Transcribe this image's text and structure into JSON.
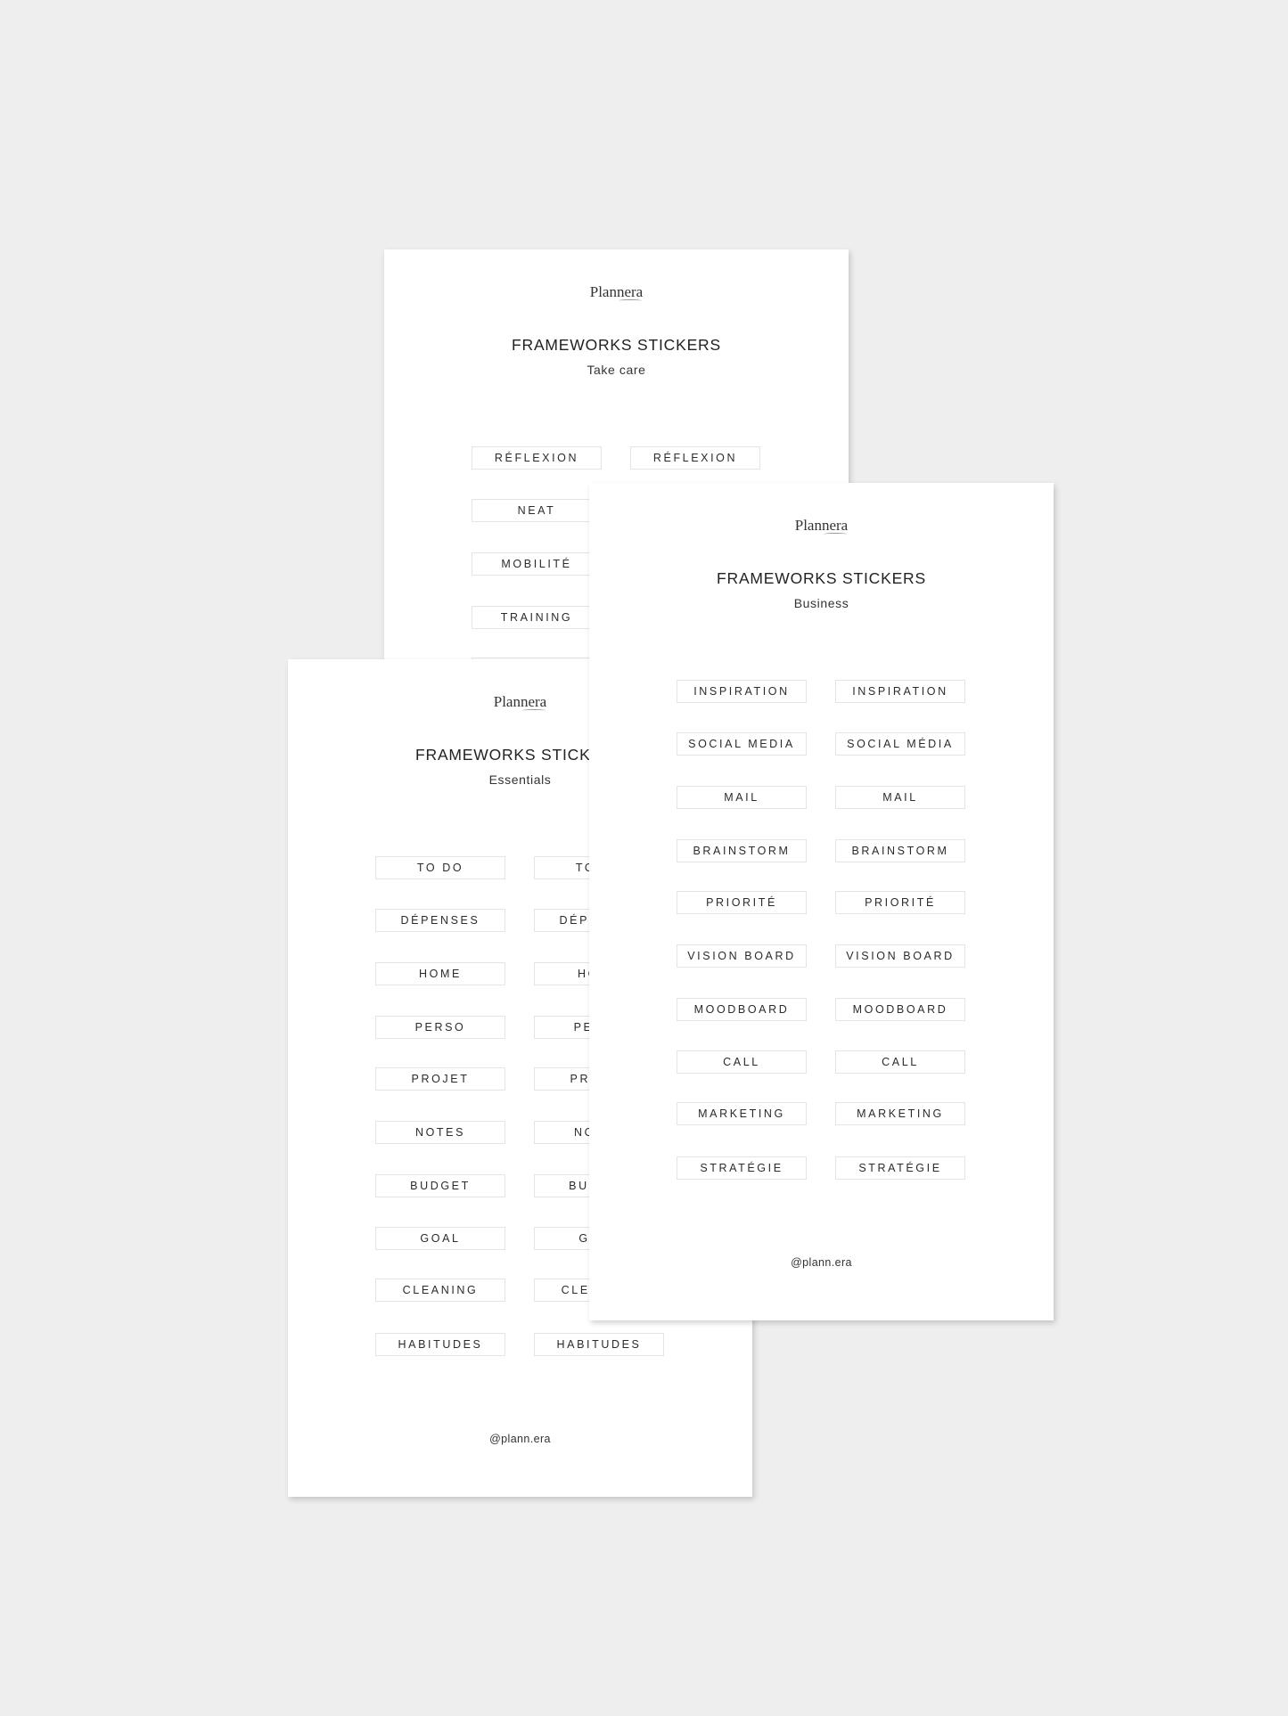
{
  "colors": {
    "background": "#eeeeee",
    "page": "#ffffff",
    "text": "#2b2b2b",
    "sticker_border": "#e4e4e4"
  },
  "pages": [
    {
      "id": "page-a",
      "logo": "Plannera",
      "title": "FRAMEWORKS STICKERS",
      "subtitle": "Take care",
      "rows": [
        [
          "RÉFLEXION",
          "RÉFLEXION"
        ],
        [
          "NEAT",
          ""
        ],
        [
          "MOBILITÉ",
          ""
        ],
        [
          "TRAINING",
          ""
        ],
        [
          "",
          ""
        ]
      ],
      "footer": ""
    },
    {
      "id": "page-c",
      "logo": "Plannera",
      "title": "FRAMEWORKS STICKERS",
      "subtitle": "Essentials",
      "rows": [
        [
          "TO DO",
          "TO DO"
        ],
        [
          "DÉPENSES",
          "DÉPENSES"
        ],
        [
          "HOME",
          "HOME"
        ],
        [
          "PERSO",
          "PERSO"
        ],
        [
          "PROJET",
          "PROJET"
        ],
        [
          "NOTES",
          "NOTES"
        ],
        [
          "BUDGET",
          "BUDGET"
        ],
        [
          "GOAL",
          "GOAL"
        ],
        [
          "CLEANING",
          "CLEANING"
        ],
        [
          "HABITUDES",
          "HABITUDES"
        ]
      ],
      "footer": "@plann.era"
    },
    {
      "id": "page-b",
      "logo": "Plannera",
      "title": "FRAMEWORKS STICKERS",
      "subtitle": "Business",
      "rows": [
        [
          "INSPIRATION",
          "INSPIRATION"
        ],
        [
          "SOCIAL MEDIA",
          "SOCIAL MÉDIA"
        ],
        [
          "MAIL",
          "MAIL"
        ],
        [
          "BRAINSTORM",
          "BRAINSTORM"
        ],
        [
          "PRIORITÉ",
          "PRIORITÉ"
        ],
        [
          "VISION BOARD",
          "VISION BOARD"
        ],
        [
          "MOODBOARD",
          "MOODBOARD"
        ],
        [
          "CALL",
          "CALL"
        ],
        [
          "MARKETING",
          "MARKETING"
        ],
        [
          "STRATÉGIE",
          "STRATÉGIE"
        ]
      ],
      "footer": "@plann.era"
    }
  ]
}
